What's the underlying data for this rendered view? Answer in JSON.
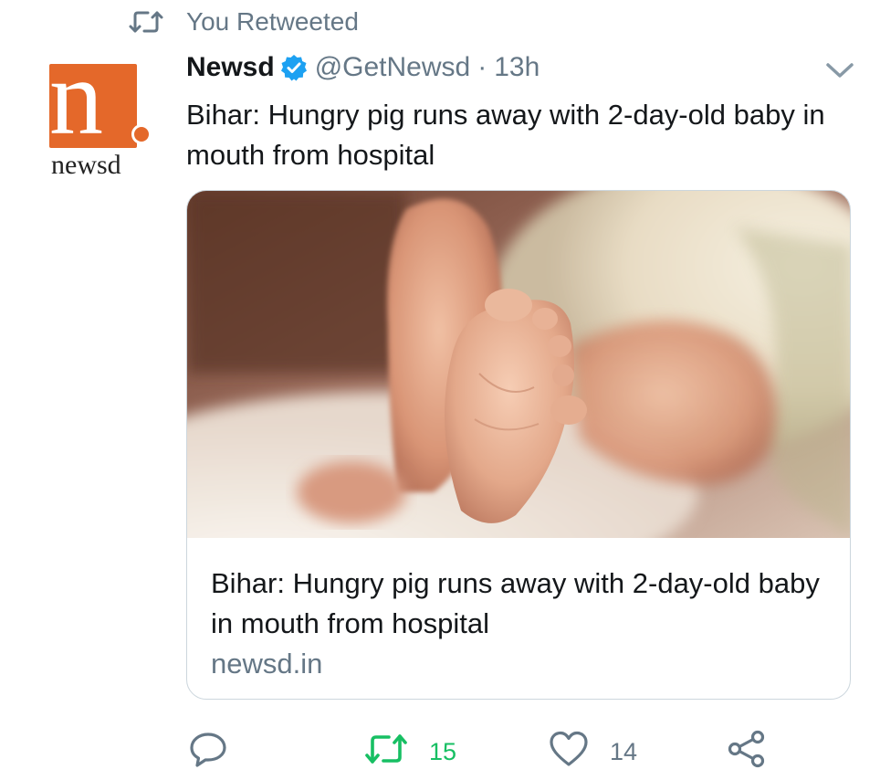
{
  "retweet_context": {
    "label": "You Retweeted",
    "icon": "retweet-icon"
  },
  "author": {
    "name": "Newsd",
    "verified": true,
    "handle": "@GetNewsd",
    "separator": "·",
    "time": "13h",
    "avatar": {
      "letter": "n",
      "wordmark": "newsd",
      "brand_color": "#e4682a"
    }
  },
  "tweet": {
    "text": "Bihar: Hungry pig runs away with 2-day-old baby in mouth from hospital"
  },
  "card": {
    "image": "baby-foot-photo",
    "title": "Bihar: Hungry pig runs away with 2-day-old baby in mouth from hospital",
    "domain": "newsd.in"
  },
  "actions": {
    "reply": {
      "icon": "reply-icon",
      "count": ""
    },
    "retweet": {
      "icon": "retweet-icon",
      "count": "15",
      "active": true,
      "color": "#17bf63"
    },
    "like": {
      "icon": "heart-icon",
      "count": "14"
    },
    "share": {
      "icon": "share-icon"
    }
  },
  "colors": {
    "text_primary": "#14171a",
    "text_secondary": "#657786",
    "verified_blue": "#1da1f2",
    "card_border": "#ccd6dd"
  }
}
